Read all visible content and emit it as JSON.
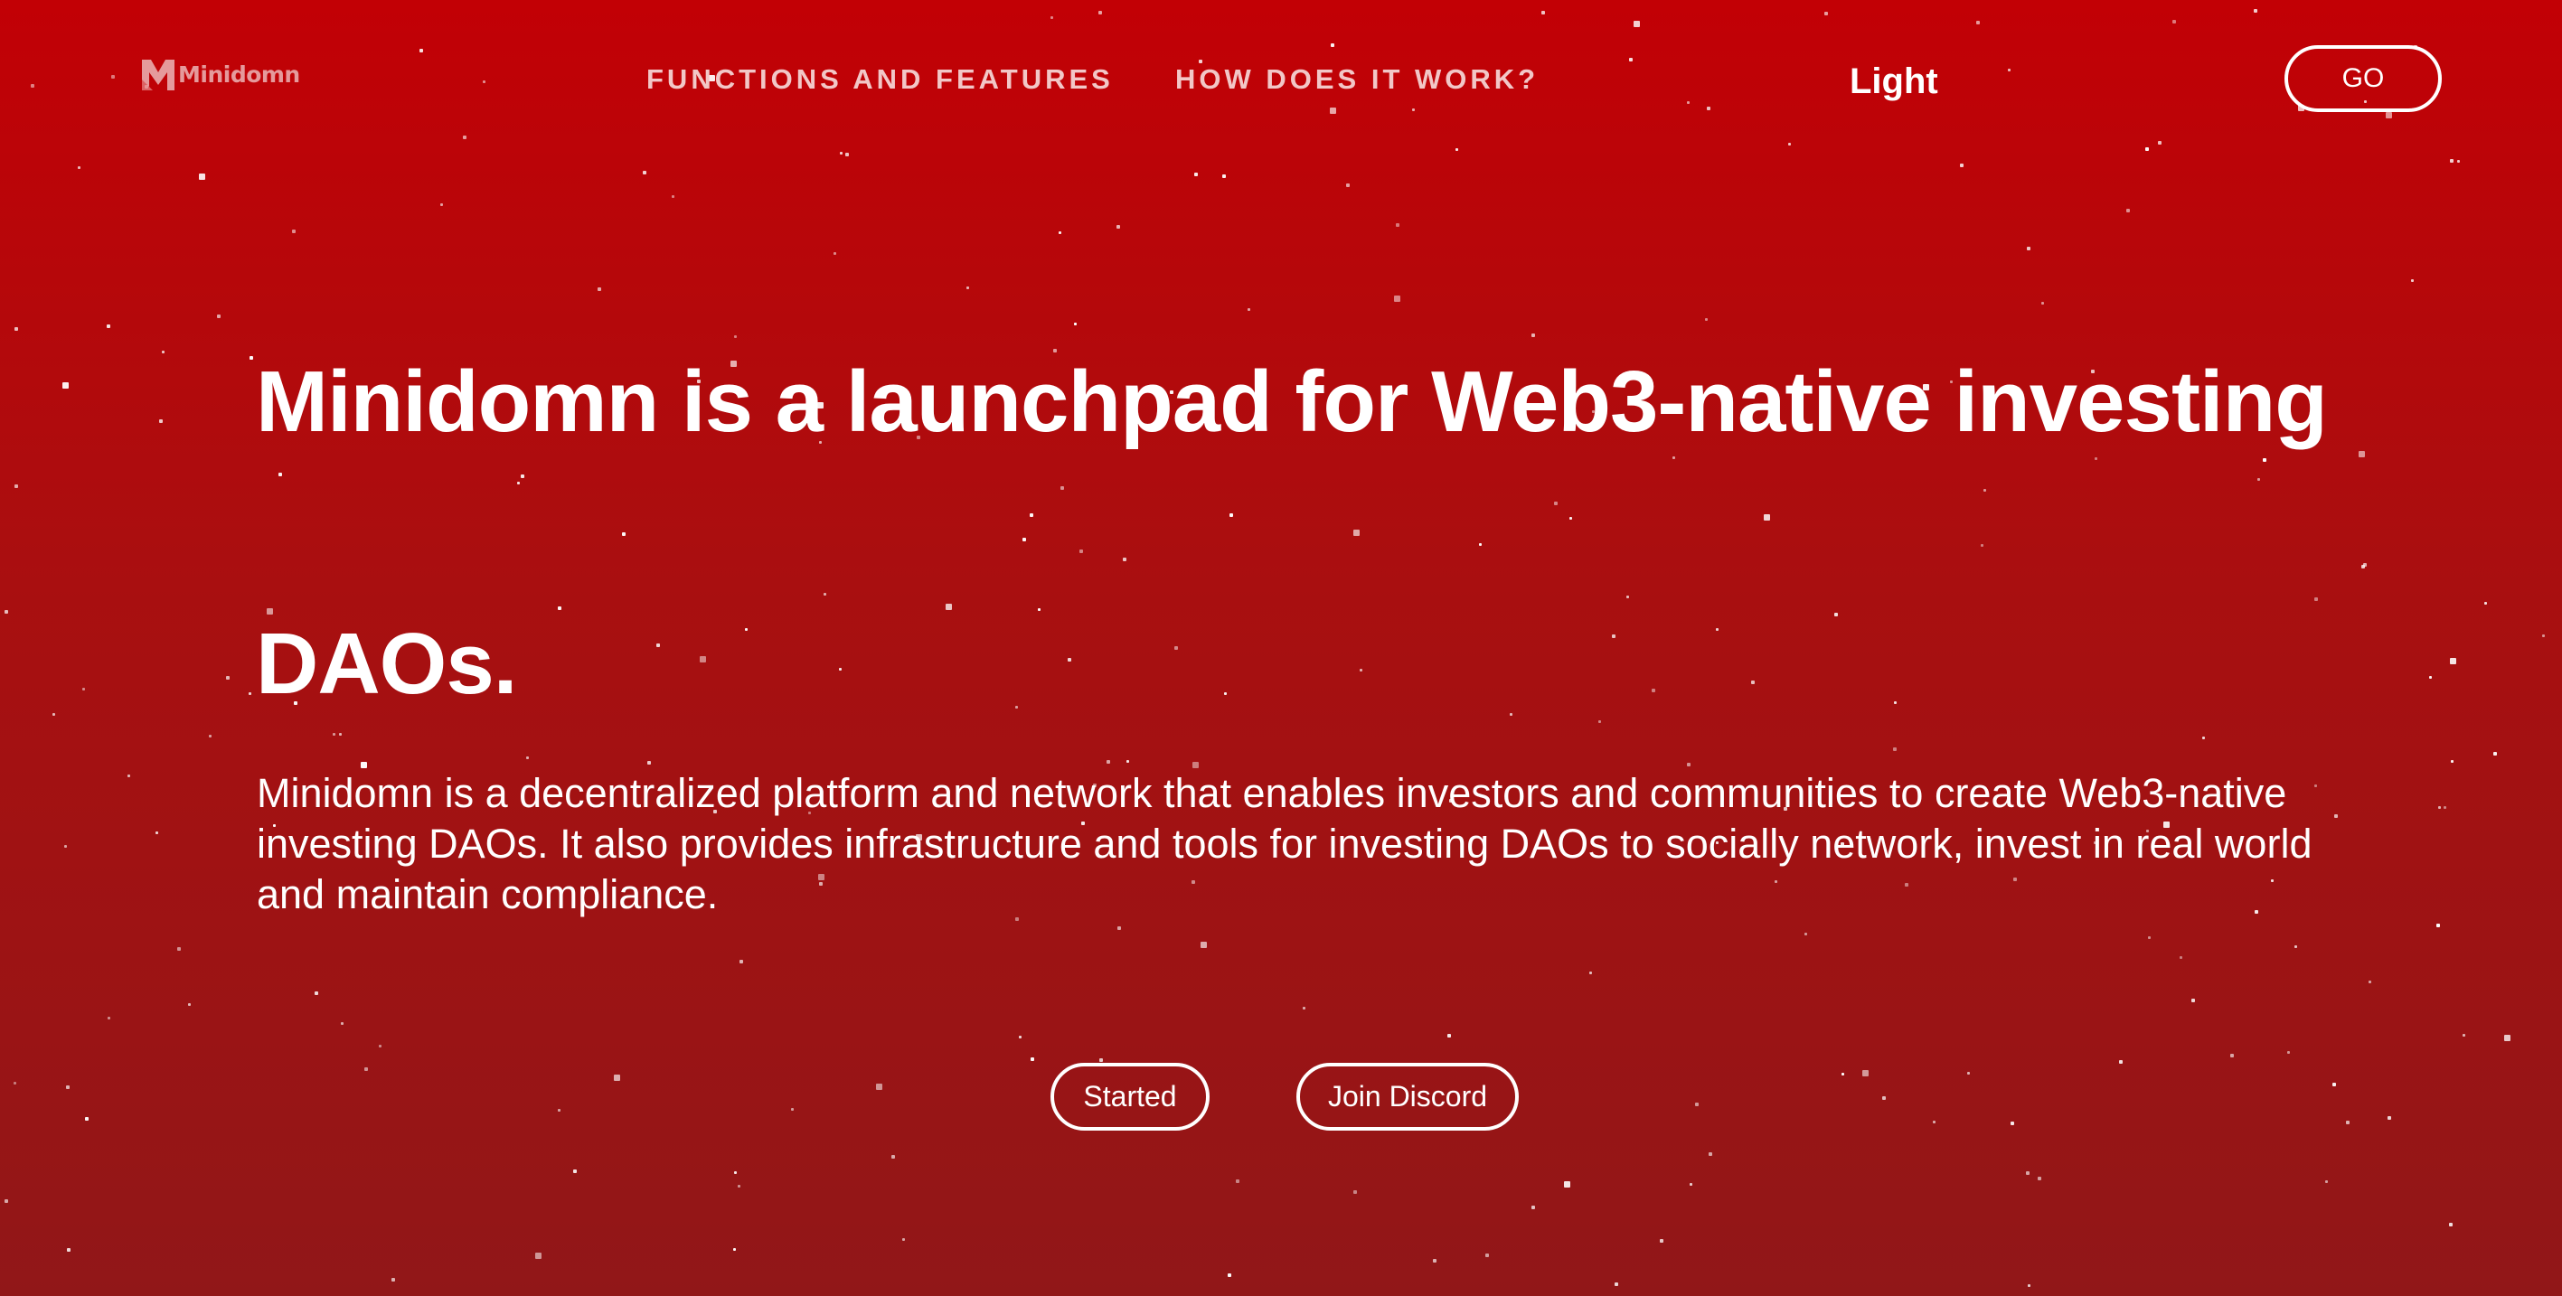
{
  "header": {
    "logo_text": "Minidomn",
    "nav": [
      {
        "label": "FUNCTIONS AND FEATURES"
      },
      {
        "label": "HOW DOES IT WORK?"
      }
    ],
    "theme_label": "Light",
    "go_label": "GO"
  },
  "hero": {
    "title_line1": "Minidomn is a launchpad for Web3-native investing",
    "title_line2": "DAOs.",
    "description": "Minidomn is a decentralized platform and network that enables investors and communities to create Web3-native investing DAOs. It also provides infrastructure and tools for investing DAOs to socially network, invest in real world and maintain compliance.",
    "buttons": {
      "started_label": "Started",
      "discord_label": "Join Discord"
    }
  },
  "colors": {
    "background_top": "#c20005",
    "background_bottom": "#911718",
    "text": "#ffffff",
    "nav_text": "#f2c7c7"
  }
}
